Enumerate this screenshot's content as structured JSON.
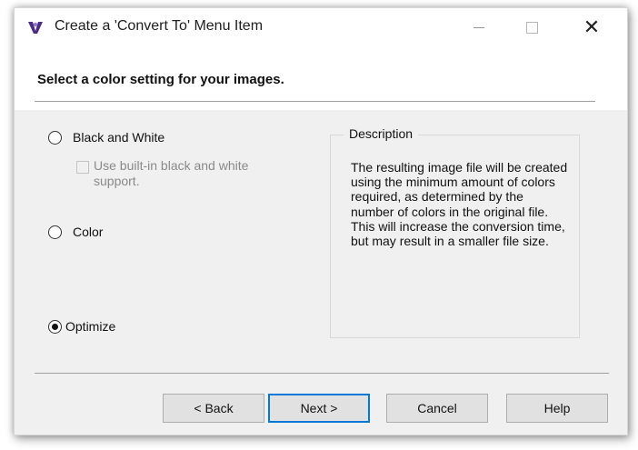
{
  "window": {
    "title": "Create a 'Convert To' Menu Item",
    "controls": {
      "minimize": "—",
      "maximize": "☐",
      "close": "✕"
    }
  },
  "header": {
    "instruction": "Select a color setting for your images."
  },
  "options": {
    "black_and_white": {
      "label": "Black and White",
      "selected": false
    },
    "builtin_checkbox": {
      "label": "Use built-in black and white support.",
      "checked": false,
      "enabled": false
    },
    "color": {
      "label": "Color",
      "selected": false
    },
    "optimize": {
      "label": "Optimize",
      "selected": true
    }
  },
  "description": {
    "legend": "Description",
    "text": "The resulting image file will be created using the minimum amount of colors required, as determined by the number of colors in the original file.  This will increase the conversion time, but may result in a smaller file size."
  },
  "buttons": {
    "back": "< Back",
    "next": "Next >",
    "cancel": "Cancel",
    "help": "Help"
  },
  "colors": {
    "accent": "#0078d7",
    "app_icon": "#4b2e83"
  }
}
